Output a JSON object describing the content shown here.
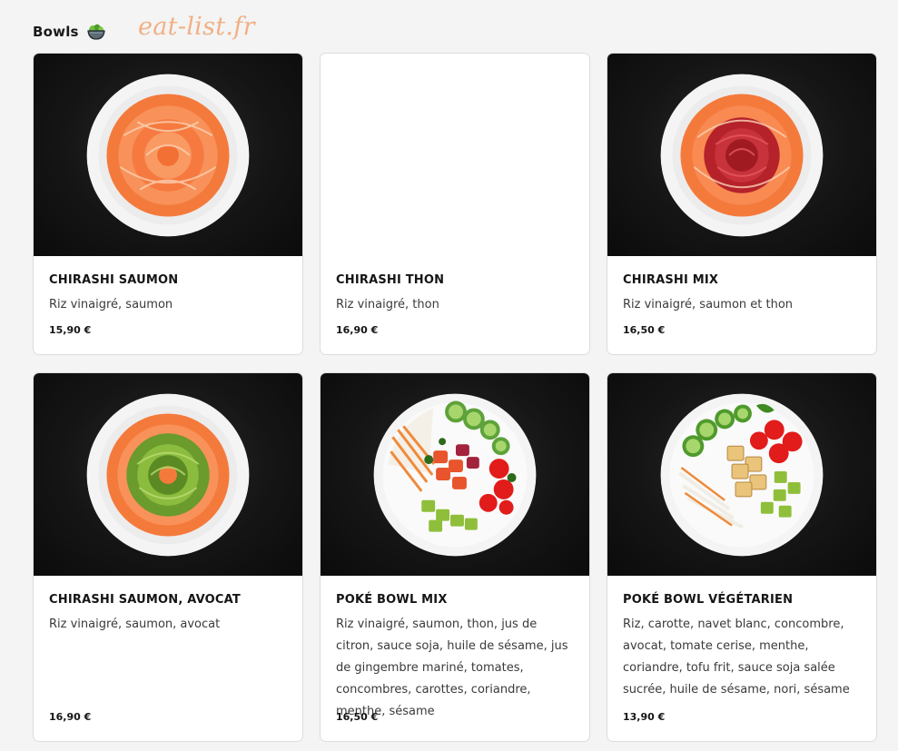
{
  "section": {
    "title": "Bowls",
    "emoji_icon": "bowl-salad-icon"
  },
  "watermark": "eat-list.fr",
  "items": [
    {
      "name": "CHIRASHI SAUMON",
      "description": "Riz vinaigré, saumon",
      "price": "15,90 €",
      "image": "salmon-rose"
    },
    {
      "name": "CHIRASHI THON",
      "description": "Riz vinaigré, thon",
      "price": "16,90 €",
      "image": "none"
    },
    {
      "name": "CHIRASHI MIX",
      "description": "Riz vinaigré, saumon et thon",
      "price": "16,50 €",
      "image": "salmon-tuna-rose"
    },
    {
      "name": "CHIRASHI SAUMON, AVOCAT",
      "description": "Riz vinaigré, saumon, avocat",
      "price": "16,90 €",
      "image": "salmon-avocado-rose"
    },
    {
      "name": "POKÉ BOWL MIX",
      "description": "Riz vinaigré, saumon, thon, jus de citron, sauce soja, huile de sésame, jus de gingembre mariné, tomates, concombres, carottes, coriandre, menthe, sésame",
      "price": "16,50 €",
      "image": "poke-mix"
    },
    {
      "name": "POKÉ BOWL VÉGÉTARIEN",
      "description": "Riz, carotte, navet blanc, concombre, avocat, tomate cerise, menthe, coriandre, tofu frit, sauce soja salée sucrée, huile de sésame, nori, sésame",
      "price": "13,90 €",
      "image": "poke-veggie"
    }
  ],
  "colors": {
    "background": "#f3f4f3",
    "card": "#ffffff",
    "photo_bg": "#111111",
    "watermark": "#f2a87a"
  }
}
